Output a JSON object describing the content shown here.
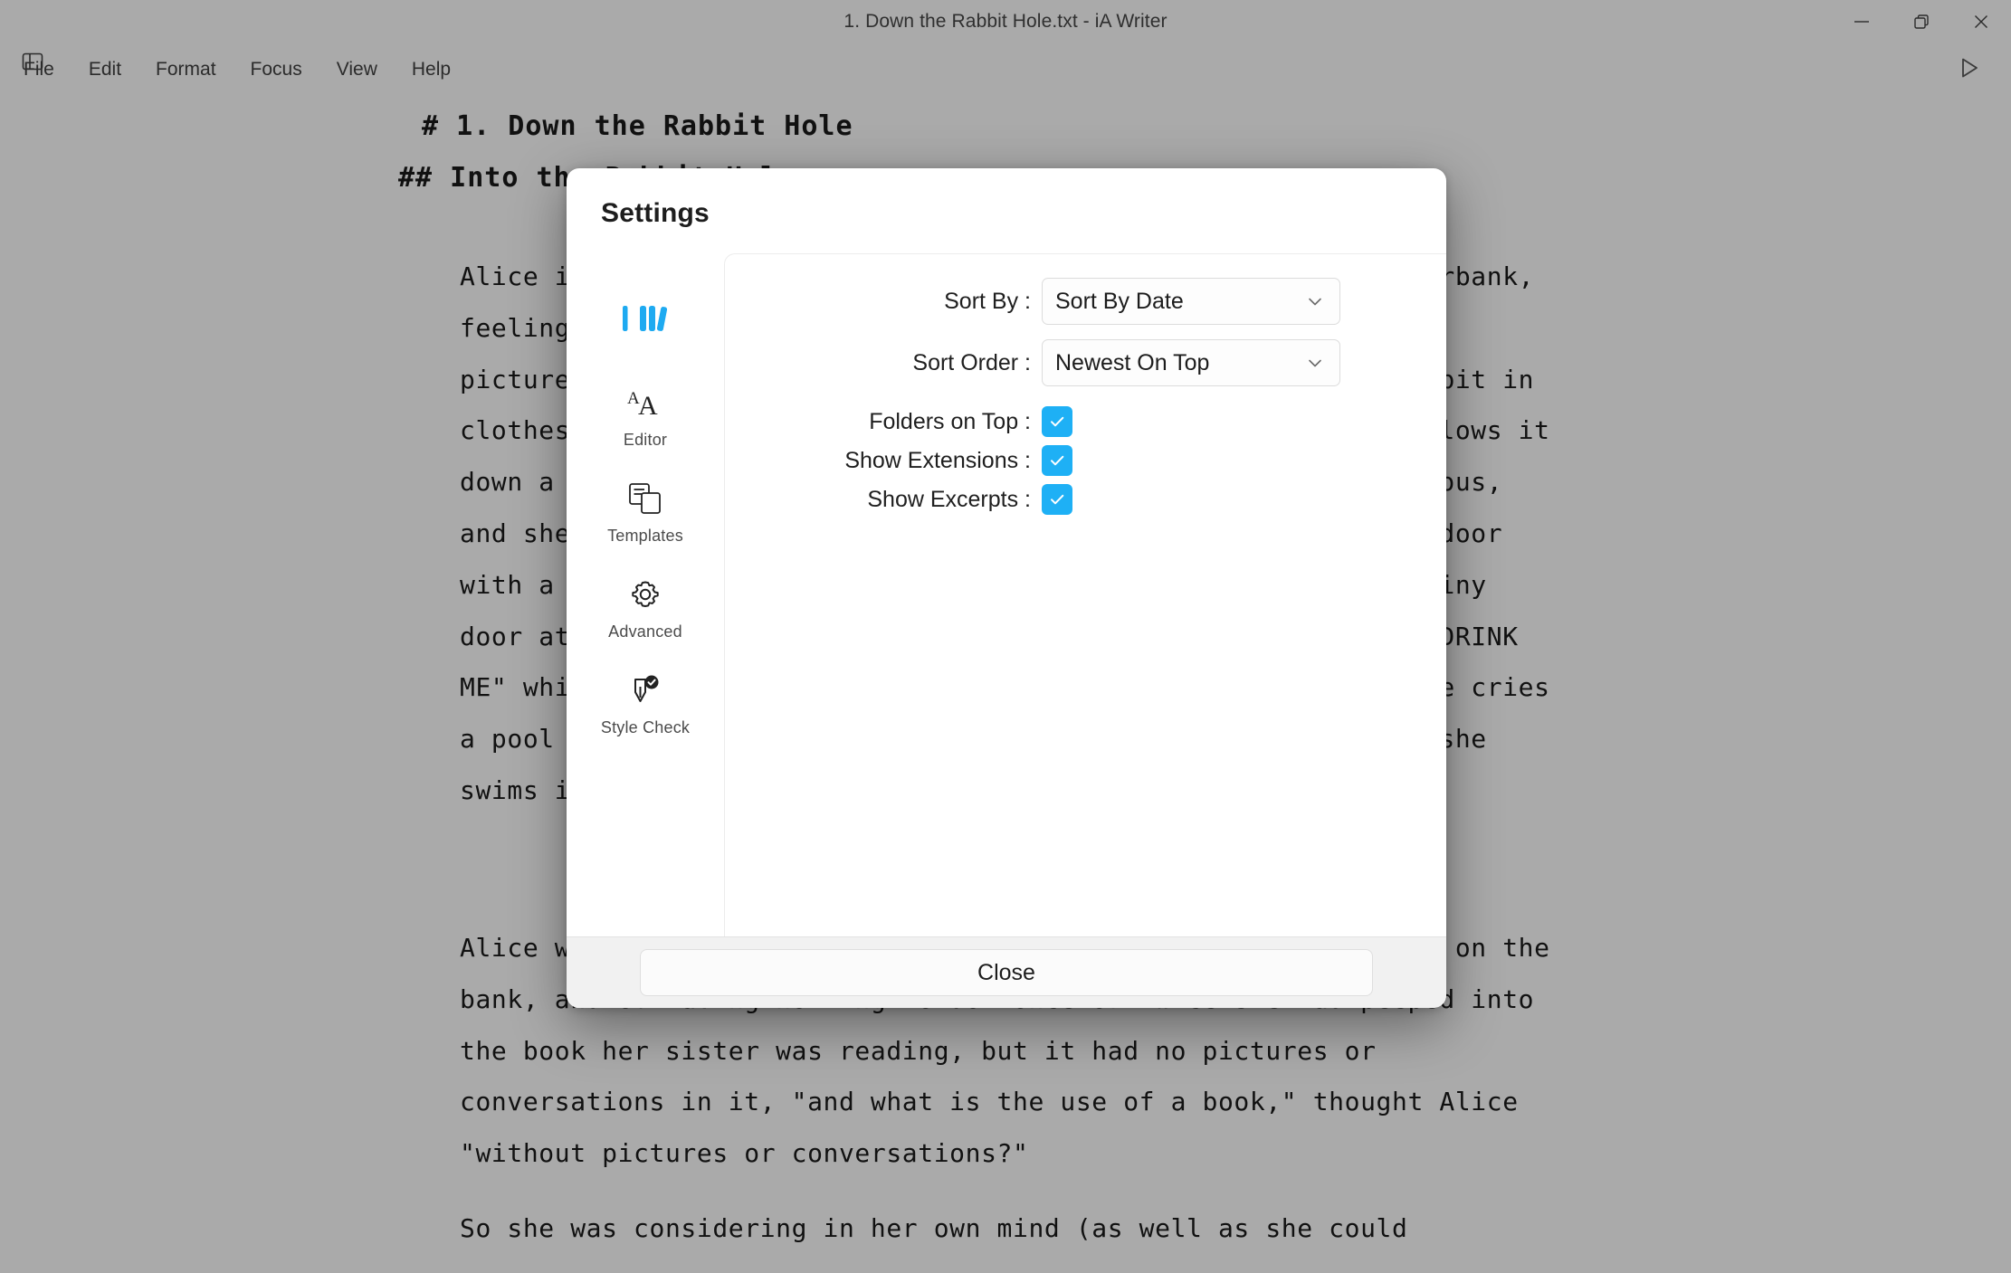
{
  "window": {
    "title": "1. Down the Rabbit Hole.txt - iA Writer",
    "controls": {
      "minimize": "minimize-icon",
      "maximize": "restore-icon",
      "close": "close-icon"
    }
  },
  "toolbar": {
    "sidebar_toggle_icon": "sidebar-panel-icon",
    "preview_icon": "play-preview-icon",
    "menu": [
      {
        "label": "File"
      },
      {
        "label": "Edit"
      },
      {
        "label": "Format"
      },
      {
        "label": "Focus"
      },
      {
        "label": "View"
      },
      {
        "label": "Help"
      }
    ]
  },
  "document": {
    "heading1": "# 1. Down the Rabbit Hole",
    "heading2": "## Into the Rabbit Hole",
    "paragraph1": "Alice is a young girl who is sitting with her sister on a riverbank, feeling bored and drowsy. Her sister is reading a book with no pictures or conversations, which Alice finds dull. A white rabbit in clothes hurries past her, mumbling about being late. Alice follows it down a rabbit hole out of curiosity. The fall is long and curious, and she lands in a hall of locked doors that leads to a small door with a garden behind it. She finds a key and looks through a tiny door at a beautiful garden, then discovers a bottle labelled \"DRINK ME\" which shrinks her, and a cake which causes her to grow. She cries a pool of tears, which has left on the floor of the hall, and she swims in it with a mouse in curious company.",
    "paragraph2": "Alice was beginning to get very tired of sitting by her sister on the bank, and of having nothing to do: once or twice she had peeped into the book her sister was reading, but it had no pictures or conversations in it, \"and what is the use of a book,\" thought Alice \"without pictures or conversations?\"",
    "paragraph3": "So she was considering in her own mind (as well as she could"
  },
  "settings_dialog": {
    "title": "Settings",
    "nav": [
      {
        "id": "library",
        "label": "",
        "icon": "books-library-icon",
        "selected": true
      },
      {
        "id": "editor",
        "label": "Editor",
        "icon": "font-size-icon",
        "selected": false
      },
      {
        "id": "templates",
        "label": "Templates",
        "icon": "templates-icon",
        "selected": false
      },
      {
        "id": "advanced",
        "label": "Advanced",
        "icon": "gear-icon",
        "selected": false
      },
      {
        "id": "stylecheck",
        "label": "Style Check",
        "icon": "pen-check-icon",
        "selected": false
      }
    ],
    "fields": {
      "sort_by_label": "Sort By :",
      "sort_by_value": "Sort By Date",
      "sort_order_label": "Sort Order :",
      "sort_order_value": "Newest On Top",
      "folders_on_top_label": "Folders on Top :",
      "folders_on_top_checked": true,
      "show_extensions_label": "Show Extensions :",
      "show_extensions_checked": true,
      "show_excerpts_label": "Show Excerpts :",
      "show_excerpts_checked": true
    },
    "close_label": "Close"
  },
  "colors": {
    "accent": "#1eb0f5",
    "window_chrome": "#aaaaaa",
    "dialog_bg": "#ffffff",
    "footer_bg": "#f1f1f1"
  }
}
